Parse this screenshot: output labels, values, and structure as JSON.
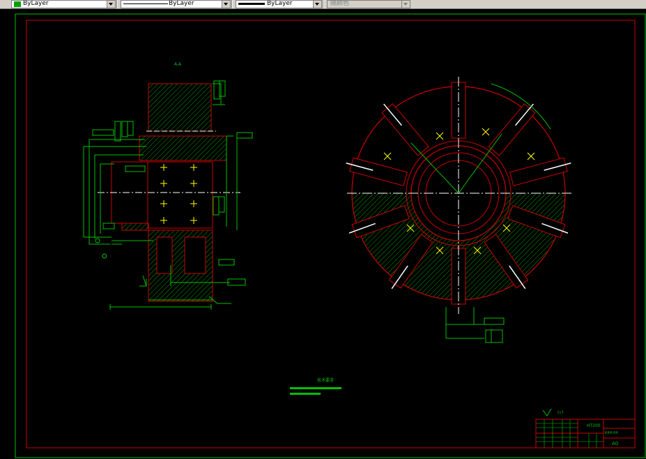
{
  "toolbar": {
    "color_combo": {
      "value": "ByLayer",
      "swatch": "#00a000"
    },
    "linetype_combo": {
      "value": "ByLayer"
    },
    "lineweight_combo": {
      "value": "ByLayer"
    },
    "plotstyle_combo": {
      "value": "随颜色"
    }
  },
  "colors": {
    "background": "#000000",
    "frame": "#cc0000",
    "dimension": "#00c000",
    "object": "#ffffff",
    "hatch": "#00a000",
    "center": "#ffff00"
  },
  "drawing": {
    "section_label": "A-A",
    "tech_requirements_title": "技术要求",
    "title_block": {
      "material": "HT200",
      "drawing_no": "K4H-04",
      "sheet_size": "A0"
    },
    "roughness_note": "(√)"
  }
}
